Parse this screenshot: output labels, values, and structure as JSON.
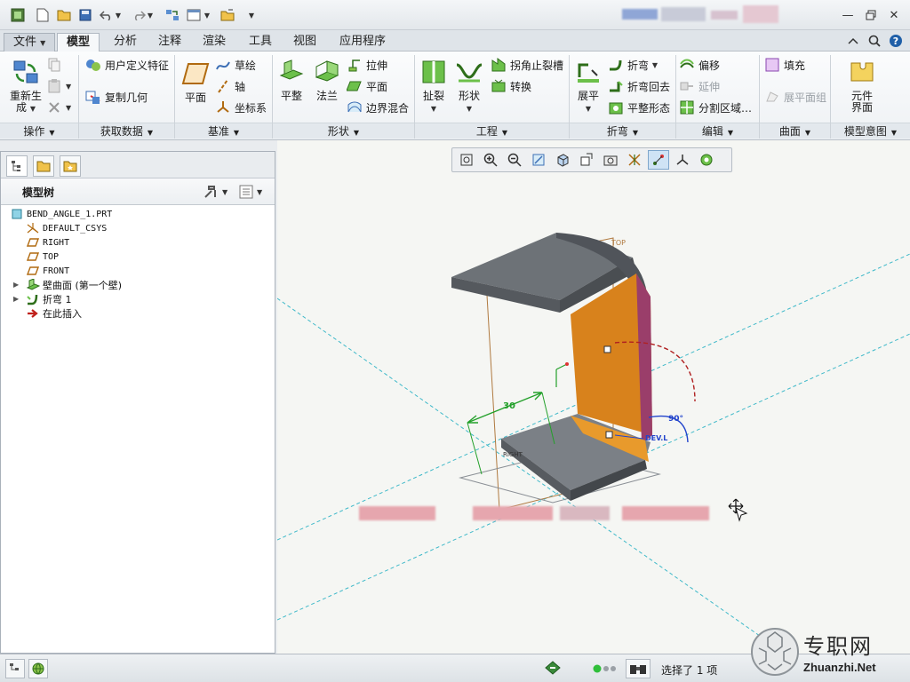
{
  "tabs": [
    {
      "label": "文件"
    },
    {
      "label": "模型"
    },
    {
      "label": "分析"
    },
    {
      "label": "注释"
    },
    {
      "label": "渲染"
    },
    {
      "label": "工具"
    },
    {
      "label": "视图"
    },
    {
      "label": "应用程序"
    }
  ],
  "ribbon": {
    "groups": {
      "operations": "操作",
      "get_data": "获取数据",
      "datum": "基准",
      "shapes": "形状",
      "engineering": "工程",
      "bends": "折弯",
      "editing": "编辑",
      "surfaces": "曲面",
      "model_intent": "模型意图"
    },
    "regenerate_line1": "重新生",
    "regenerate_line2": "成",
    "user_defined_feature": "用户定义特征",
    "copy_geometry": "复制几何",
    "plane": "平面",
    "sketch": "草绘",
    "axis": "轴",
    "csys": "坐标系",
    "planar": "平整",
    "flange": "法兰",
    "extrude": "拉伸",
    "planar_small": "平面",
    "boundary_blend": "边界混合",
    "rip": "扯裂",
    "form": "形状",
    "corner_relief": "拐角止裂槽",
    "convert": "转换",
    "unbend": "展平",
    "bend": "折弯",
    "bend_back": "折弯回去",
    "flatten_form": "平整形态",
    "offset": "偏移",
    "extend": "延伸",
    "split_area": "分割区域…",
    "fill": "填充",
    "flat_pattern_group": "展平面组",
    "component_interface_line1": "元件",
    "component_interface_line2": "界面"
  },
  "tree": {
    "title": "模型树",
    "items": [
      {
        "label": "BEND_ANGLE_1.PRT"
      },
      {
        "label": "DEFAULT_CSYS"
      },
      {
        "label": "RIGHT"
      },
      {
        "label": "TOP"
      },
      {
        "label": "FRONT"
      },
      {
        "label": "壁曲面 (第一个壁)"
      },
      {
        "label": "折弯 1"
      },
      {
        "label": "在此插入"
      }
    ]
  },
  "graphics": {
    "datum_top_label": "TOP",
    "dim_30": "30",
    "dim_90": "90°",
    "dev_label": "DEV.L",
    "right_label": "RIGHT"
  },
  "status": {
    "selected": "选择了 1 项"
  },
  "watermark": {
    "brand": "专职网",
    "url": "Zhuanzhi.Net"
  },
  "colors": {
    "accent_orange": "#e08a1e",
    "model_gray": "#7b8086",
    "datum_cyan": "#3fb9c9"
  }
}
